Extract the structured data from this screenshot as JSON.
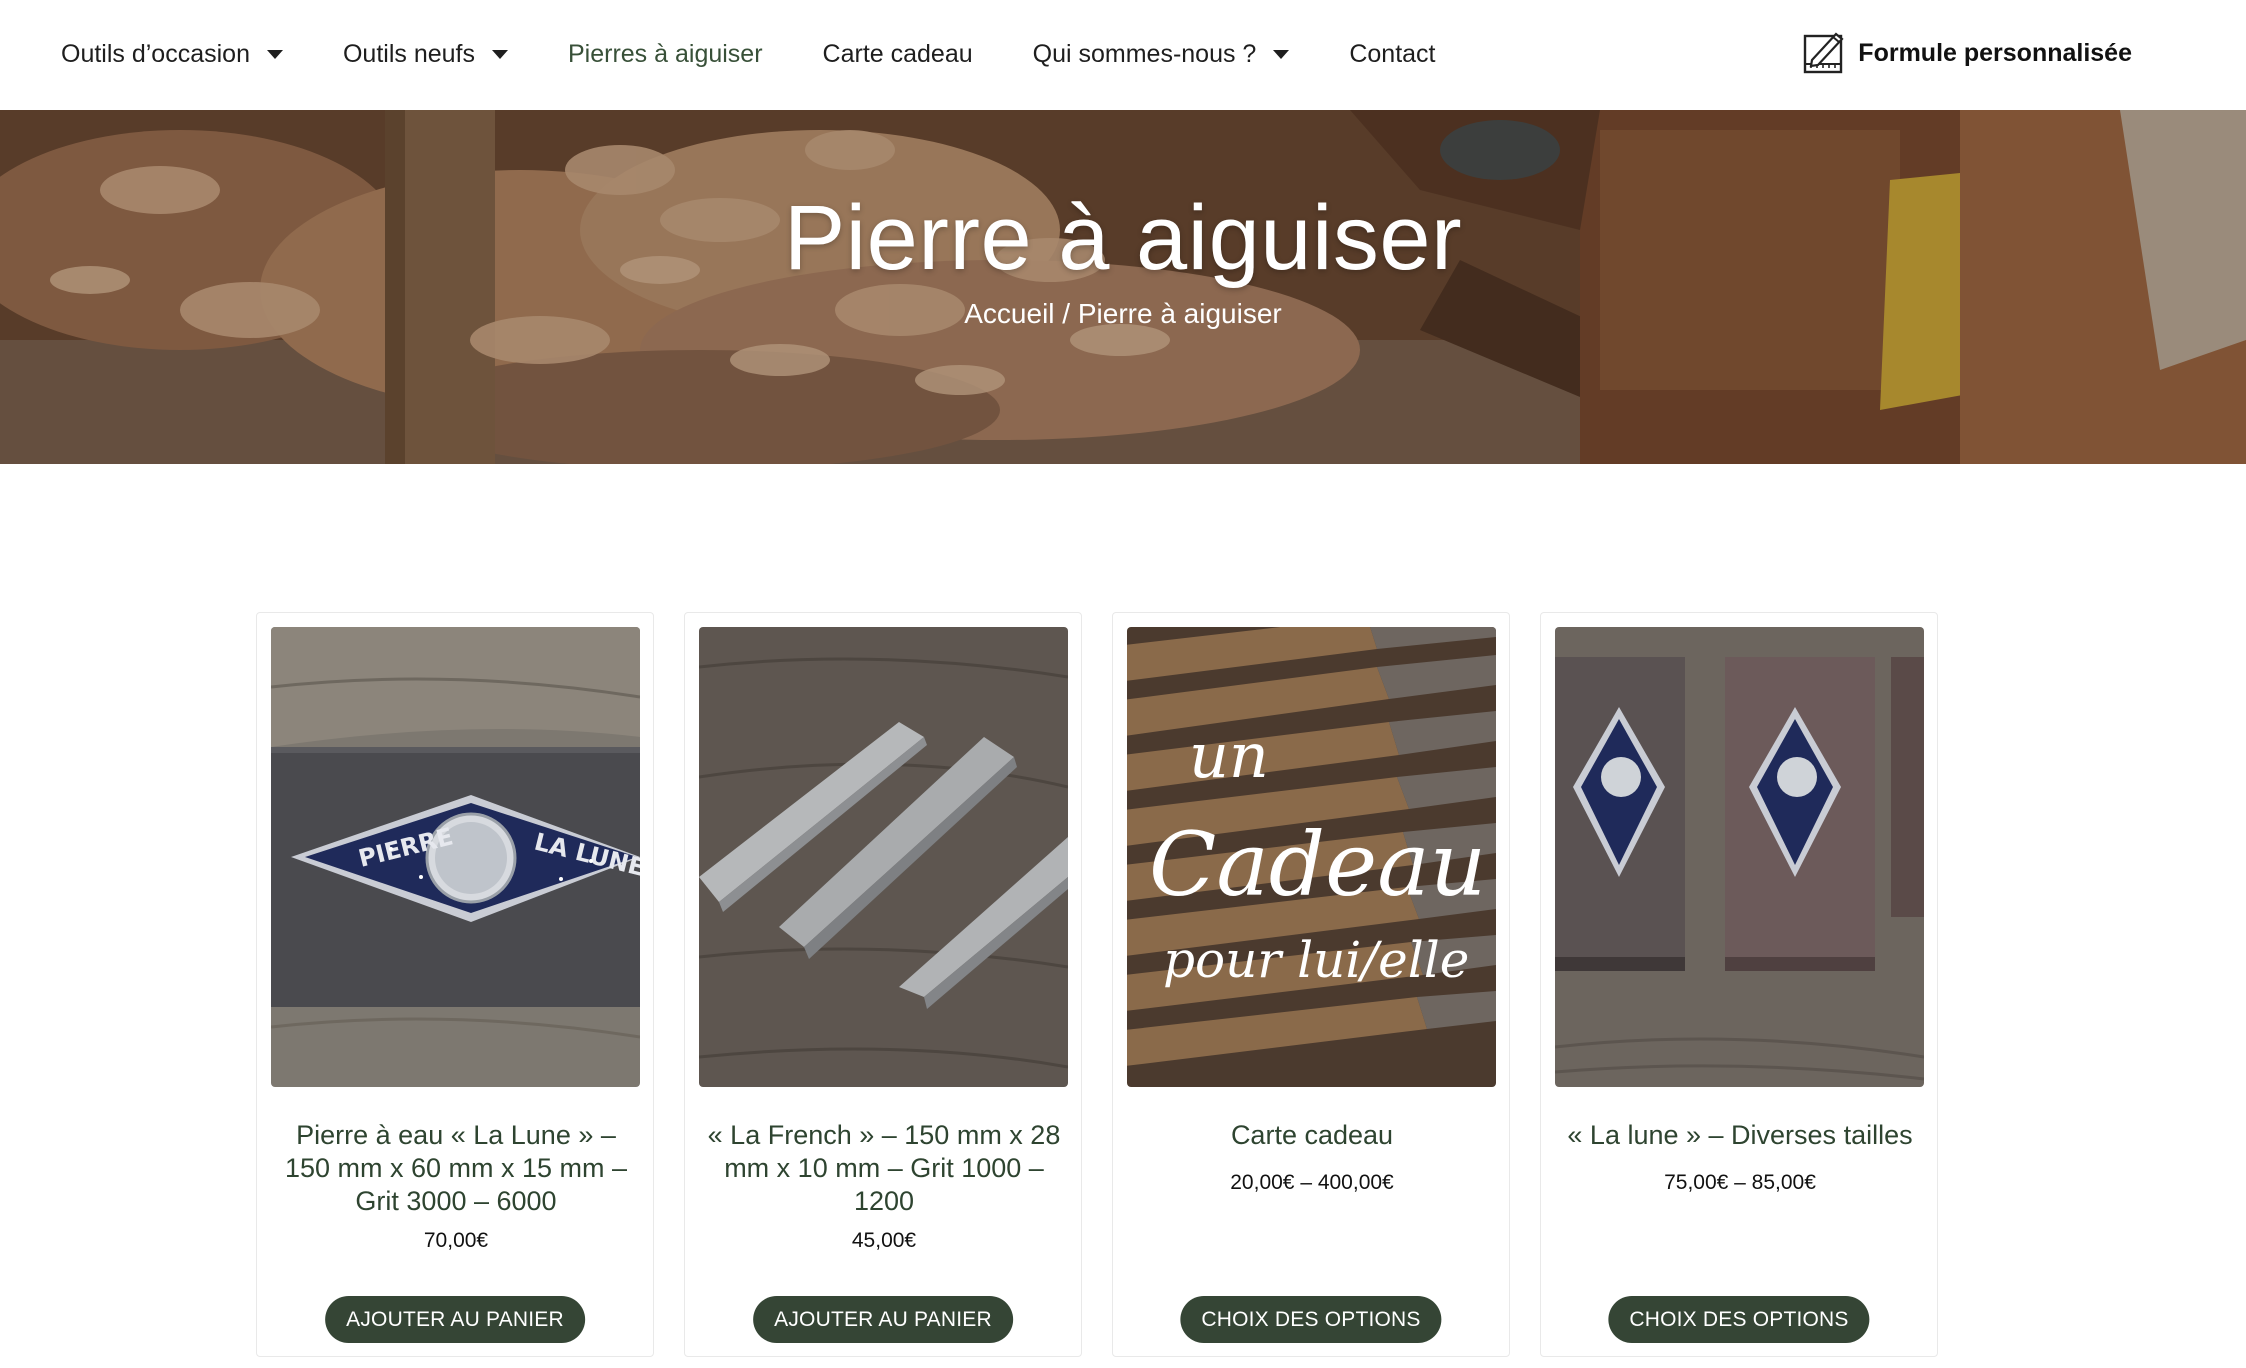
{
  "nav": {
    "items": [
      {
        "label": "Outils d’occasion",
        "has_dropdown": true
      },
      {
        "label": "Outils neufs",
        "has_dropdown": true
      },
      {
        "label": "Pierres à aiguiser",
        "has_dropdown": false,
        "active": true
      },
      {
        "label": "Carte cadeau",
        "has_dropdown": false
      },
      {
        "label": "Qui sommes-nous ?",
        "has_dropdown": true
      },
      {
        "label": "Contact",
        "has_dropdown": false
      }
    ],
    "formule_label": "Formule personnalisée",
    "formule_icon": "ruler-pencil-icon"
  },
  "hero": {
    "title": "Pierre à aiguiser",
    "breadcrumb_home": "Accueil",
    "breadcrumb_separator": " / ",
    "breadcrumb_current": "Pierre à aiguiser"
  },
  "products": [
    {
      "title": "Pierre à eau « La Lune » – 150 mm x 60 mm x 15 mm – Grit 3000 – 6000",
      "price": "70,00€",
      "button": "AJOUTER AU PANIER"
    },
    {
      "title": "« La French » – 150 mm x 28 mm x 10 mm – Grit 1000 – 1200",
      "price": "45,00€",
      "button": "AJOUTER AU PANIER"
    },
    {
      "title": "Carte cadeau",
      "price": "20,00€ – 400,00€",
      "button": "CHOIX DES OPTIONS",
      "image_text": {
        "line1": "un",
        "line2": "Cadeau",
        "line3": "pour lui/elle"
      }
    },
    {
      "title": "« La lune » – Diverses tailles",
      "price": "75,00€ – 85,00€",
      "button": "CHOIX DES OPTIONS"
    }
  ],
  "colors": {
    "accent": "#354535",
    "title_green": "#2e4430",
    "active_nav": "#385038"
  }
}
